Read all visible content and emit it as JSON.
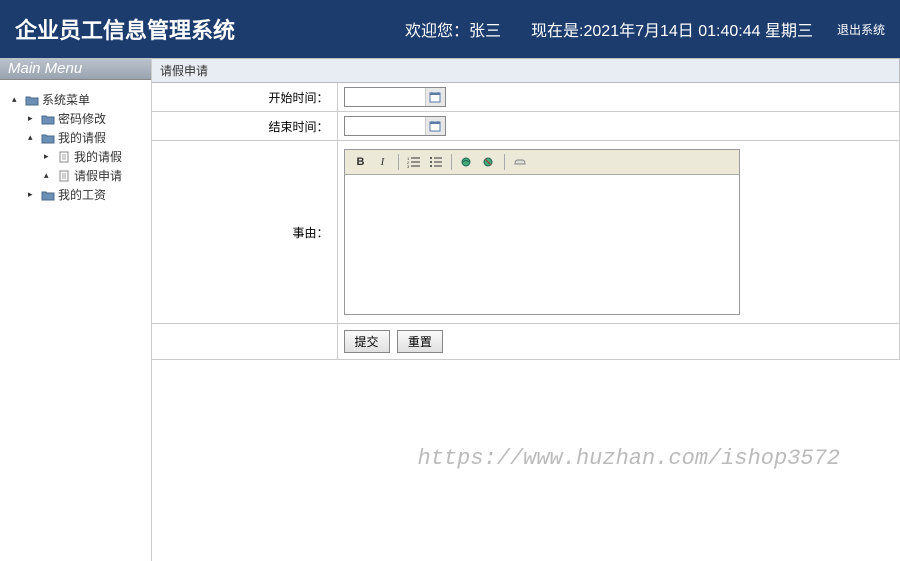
{
  "header": {
    "title": "企业员工信息管理系统",
    "welcome_prefix": "欢迎您：",
    "username": "张三",
    "datetime_prefix": "现在是:",
    "datetime": "2021年7月14日 01:40:44 星期三",
    "logout": "退出系统"
  },
  "sidebar": {
    "title": "Main Menu",
    "tree": [
      {
        "label": "系统菜单",
        "indent": 0,
        "toggle": "▴",
        "icon": "folder"
      },
      {
        "label": "密码修改",
        "indent": 1,
        "toggle": "▸",
        "icon": "folder"
      },
      {
        "label": "我的请假",
        "indent": 1,
        "toggle": "▴",
        "icon": "folder"
      },
      {
        "label": "我的请假",
        "indent": 2,
        "toggle": "▸",
        "icon": "file"
      },
      {
        "label": "请假申请",
        "indent": 2,
        "toggle": "▴",
        "icon": "file"
      },
      {
        "label": "我的工资",
        "indent": 1,
        "toggle": "▸",
        "icon": "folder"
      }
    ]
  },
  "panel": {
    "title": "请假申请"
  },
  "form": {
    "start_label": "开始时间：",
    "end_label": "结束时间：",
    "reason_label": "事由：",
    "start_value": "",
    "end_value": "",
    "submit": "提交",
    "reset": "重置"
  },
  "editor": {
    "bold": "B",
    "italic": "I"
  },
  "watermark": "https://www.huzhan.com/ishop3572"
}
